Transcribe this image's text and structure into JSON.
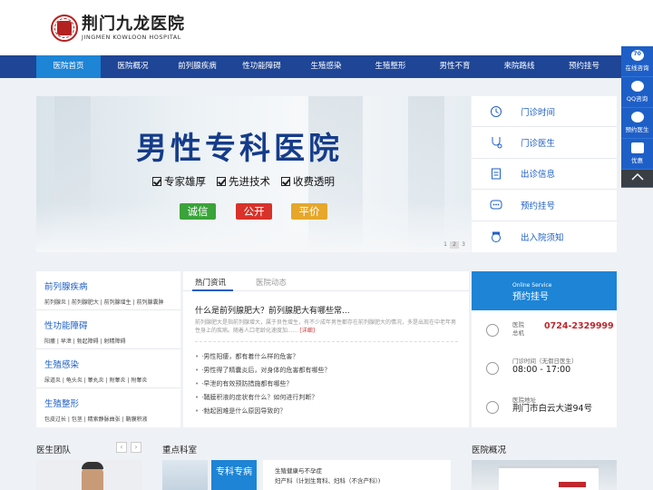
{
  "header": {
    "logo_cn": "荆门九龙医院",
    "logo_en": "JINGMEN KOWLOON HOSPITAL"
  },
  "nav": [
    {
      "label": "医院首页",
      "active": true
    },
    {
      "label": "医院概况"
    },
    {
      "label": "前列腺疾病"
    },
    {
      "label": "性功能障碍"
    },
    {
      "label": "生殖感染"
    },
    {
      "label": "生殖整形"
    },
    {
      "label": "男性不育"
    },
    {
      "label": "来院路线"
    },
    {
      "label": "预约挂号"
    }
  ],
  "side": {
    "items": [
      {
        "label": "在线咨询",
        "badge": "70",
        "icon": "chat-icon"
      },
      {
        "label": "QQ咨询",
        "icon": "qq-icon"
      },
      {
        "label": "预约医生",
        "icon": "bubble-icon"
      },
      {
        "label": "优惠",
        "icon": "coupon-icon"
      }
    ],
    "top_icon": "chevron-up-icon"
  },
  "banner": {
    "title": "男性专科医院",
    "features": [
      "专家雄厚",
      "先进技术",
      "收费透明"
    ],
    "tags": [
      {
        "label": "诚信",
        "color": "#3aa33a"
      },
      {
        "label": "公开",
        "color": "#d8322a"
      },
      {
        "label": "平价",
        "color": "#e6a72a"
      }
    ],
    "pager": [
      "1",
      "2",
      "3"
    ],
    "pager_active": 2
  },
  "quick_links": [
    {
      "label": "门诊时间",
      "icon": "clock-icon"
    },
    {
      "label": "门诊医生",
      "icon": "stethoscope-icon"
    },
    {
      "label": "出诊信息",
      "icon": "clipboard-icon"
    },
    {
      "label": "预约挂号",
      "icon": "chat-dots-icon"
    },
    {
      "label": "出入院须知",
      "icon": "nurse-icon"
    }
  ],
  "categories": [
    {
      "title": "前列腺疾病",
      "links": "前列腺炎 | 前列腺肥大 | 前列腺增生 | 前列腺囊肿"
    },
    {
      "title": "性功能障碍",
      "links": "阳痿 | 早泄 | 勃起障碍 | 射精障碍"
    },
    {
      "title": "生殖感染",
      "links": "尿道炎 | 龟头炎 | 睾丸炎 | 附睾炎 | 附睾炎"
    },
    {
      "title": "生殖整形",
      "links": "包皮过长 | 包茎 | 精索静脉曲张 | 鞘膜积液"
    }
  ],
  "news": {
    "tabs": [
      "热门资讯",
      "医院动态"
    ],
    "headline": "什么是前列腺肥大？前列腺肥大有哪些常...",
    "summary": "前列腺肥大是指前列腺增大，属于良性增生，有不少成年男性都存在前列腺肥大的情况，多是出现在中老年男性身上的疾病。随着人口老龄化速度加......",
    "more": "[详细]",
    "items": [
      "·男性阳痿，都有着什么样的危害？",
      "·男性得了精囊炎后，对身体的危害都有哪些？",
      "·早泄的有效预防措施都有哪些？",
      "·鞘膜积液的症状有什么？如何进行判断？",
      "·勃起困难是什么原因导致的？"
    ]
  },
  "info": {
    "en": "Online Service",
    "title": "预约挂号",
    "phone_label_1": "医院",
    "phone_label_2": "总机",
    "phone": "0724-2329999",
    "time_label": "门诊时间（无假日医生）",
    "time": "08:00 - 17:00",
    "addr_label": "医院地址",
    "addr": "荆门市白云大道94号"
  },
  "sections": {
    "doctors": "医生团队",
    "depts": "重点科室",
    "overview": "医院概况",
    "prev": "‹",
    "next": "›"
  },
  "dept": {
    "box": "专科专病",
    "items": [
      "生殖健康与不孕症",
      "妇产科（计划生育科、妇科（不含产科）)"
    ]
  },
  "colors": {
    "nav": "#1e4596",
    "accent": "#1d84d6",
    "brand_red": "#c0272d"
  }
}
